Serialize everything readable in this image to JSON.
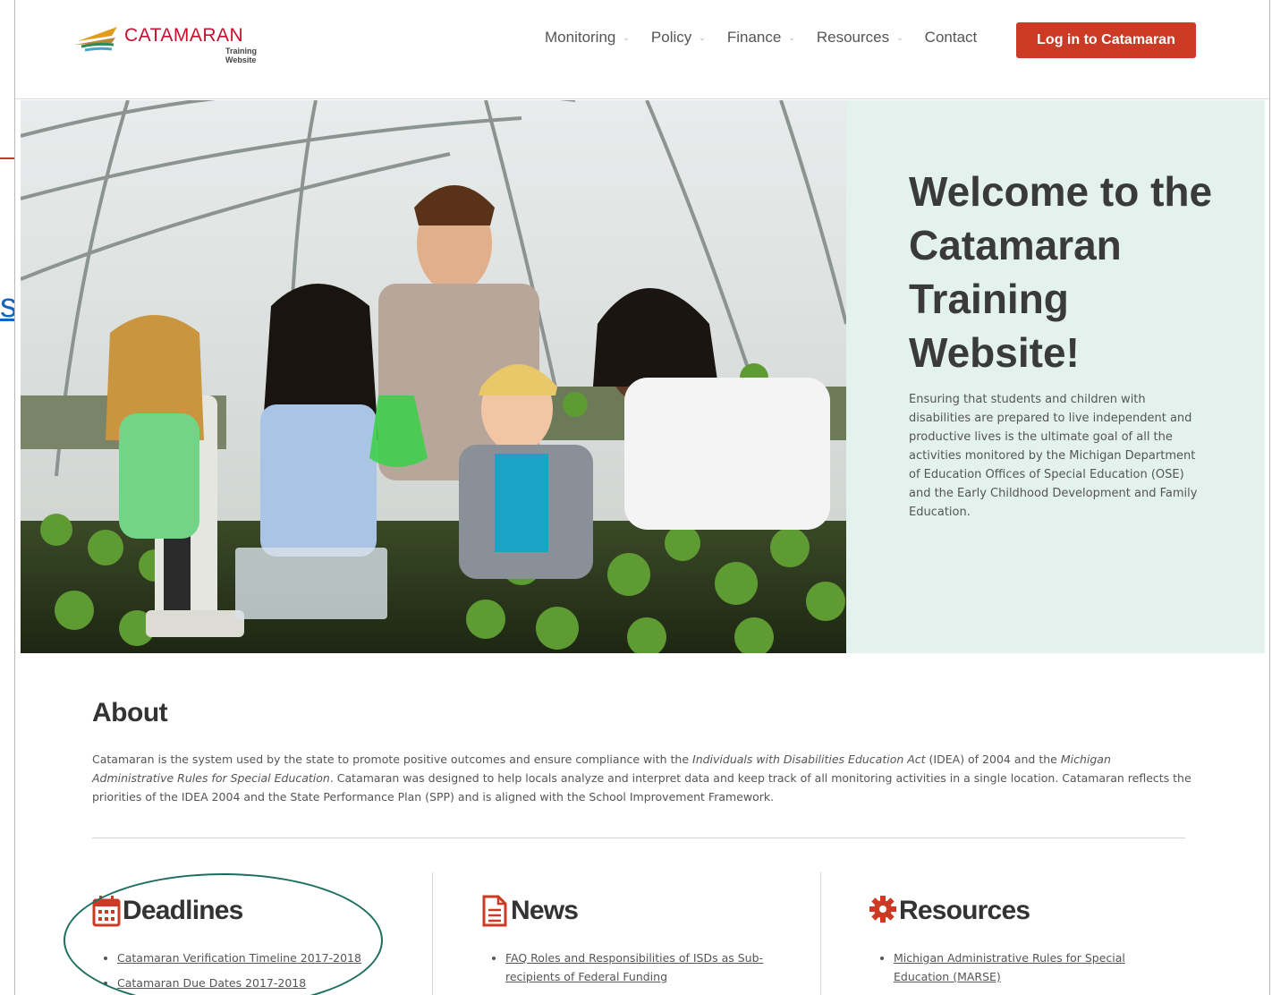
{
  "header": {
    "logo_text": "CATAMARAN",
    "logo_subtitle": "Training Website",
    "nav": [
      {
        "label": "Monitoring"
      },
      {
        "label": "Policy"
      },
      {
        "label": "Finance"
      },
      {
        "label": "Resources"
      },
      {
        "label": "Contact"
      }
    ],
    "login_label": "Log in to Catamaran"
  },
  "hero": {
    "title": "Welcome to the Catamaran Training Website!",
    "text": "Ensuring that students and children with disabilities are prepared to live independent and productive lives is the ultimate goal of all the activities monitored by the Michigan Department of Education Offices of Special Education (OSE) and the Early Childhood Development and Family Education."
  },
  "about": {
    "title": "About",
    "text_1": "Catamaran is the system used by the state to promote positive outcomes and ensure compliance with the ",
    "text_idea": "Individuals with Disabilities Education Act",
    "text_2": " (IDEA) of 2004 and the ",
    "text_marse": "Michigan Administrative Rules for Special Education",
    "text_3": ". Catamaran was designed to help locals analyze and interpret data and keep track of all monitoring activities in a single location. Catamaran reflects the priorities of the IDEA 2004 and the State Performance Plan (SPP) and is aligned with the School Improvement Framework."
  },
  "columns": {
    "deadlines": {
      "title": "Deadlines",
      "icon": "calendar-icon",
      "links": [
        "Catamaran Verification Timeline 2017-2018",
        "Catamaran Due Dates 2017-2018"
      ]
    },
    "news": {
      "title": "News",
      "icon": "document-icon",
      "links": [
        "FAQ Roles and Responsibilities of ISDs as Sub-recipients of Federal Funding"
      ]
    },
    "resources": {
      "title": "Resources",
      "icon": "gear-icon",
      "links": [
        "Michigan Administrative Rules for Special Education (MARSE)"
      ]
    }
  },
  "colors": {
    "accent": "#cb3a25",
    "hero_panel": "#e3f2ed",
    "annotation": "#1d6e5e"
  }
}
